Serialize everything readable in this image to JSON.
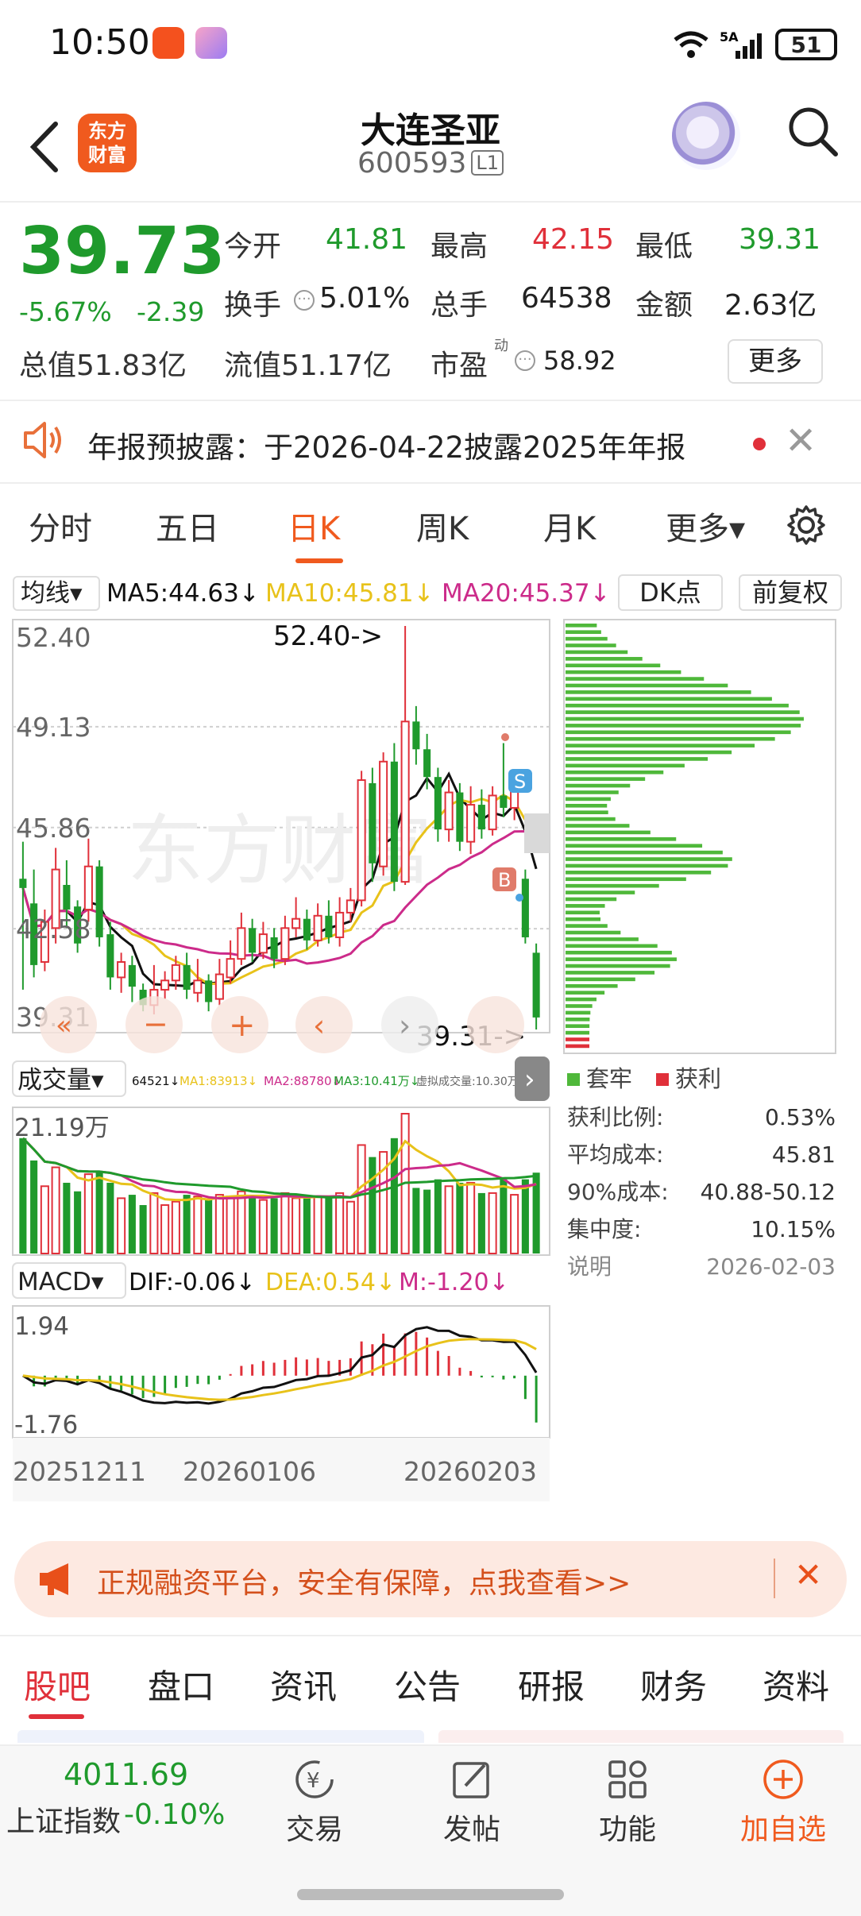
{
  "status_bar": {
    "time": "10:50",
    "battery": "51",
    "network": "5A"
  },
  "header": {
    "stock_name": "大连圣亚",
    "stock_code": "600593",
    "level_badge": "L1",
    "logo_text_line1": "东方",
    "logo_text_line2": "财富"
  },
  "quote": {
    "price": "39.73",
    "change_pct": "-5.67%",
    "change_amt": "-2.39",
    "open_label": "今开",
    "open": "41.81",
    "high_label": "最高",
    "high": "42.15",
    "low_label": "最低",
    "low": "39.31",
    "turnover_label": "换手",
    "turnover": "5.01%",
    "volume_label": "总手",
    "volume": "64538",
    "amount_label": "金额",
    "amount": "2.63亿",
    "total_cap": "总值51.83亿",
    "float_cap": "流值51.17亿",
    "pe_label": "市盈",
    "pe_sup": "动",
    "pe": "58.92",
    "more_label": "更多"
  },
  "notice": {
    "text": "年报预披露：于2026-04-22披露2025年年报"
  },
  "period_tabs": [
    "分时",
    "五日",
    "日K",
    "周K",
    "月K",
    "更多▾"
  ],
  "ma_legend": {
    "select": "均线▾",
    "ma5": "MA5:44.63↓",
    "ma10": "MA10:45.81↓",
    "ma20": "MA20:45.37↓",
    "dk_button": "DK点",
    "adjust_button": "前复权"
  },
  "kline": {
    "y_labels": [
      "52.40",
      "49.13",
      "45.86",
      "42.58",
      "39.31"
    ],
    "max_marker": "52.40->",
    "min_marker": "39.31->",
    "buy_sign": "B",
    "sell_sign": "S",
    "watermark": "东方财富"
  },
  "volume": {
    "select": "成交量▾",
    "legend": [
      "64521↓",
      "MA1:83913↓",
      "MA2:88780↓",
      "MA3:10.41万↓",
      "虚拟成交量:10.30万"
    ],
    "y_label": "21.19万"
  },
  "macd": {
    "select": "MACD▾",
    "dif": "DIF:-0.06↓",
    "dea": "DEA:0.54↓",
    "m": "M:-1.20↓",
    "y_top": "1.94",
    "y_bottom": "-1.76"
  },
  "x_dates": [
    "20251211",
    "20260106",
    "20260203"
  ],
  "chip": {
    "legend_hold": "套牢",
    "legend_profit": "获利",
    "rows": [
      {
        "label": "获利比例:",
        "value": "0.53%"
      },
      {
        "label": "平均成本:",
        "value": "45.81"
      },
      {
        "label": "90%成本:",
        "value": "40.88-50.12"
      },
      {
        "label": "集中度:",
        "value": "10.15%"
      },
      {
        "label": "说明",
        "value": "2026-02-03"
      }
    ]
  },
  "ad": {
    "text": "正规融资平台，安全有保障，点我查看>>"
  },
  "content_tabs": [
    "股吧",
    "盘口",
    "资讯",
    "公告",
    "研报",
    "财务",
    "资料"
  ],
  "bottom_nav": {
    "index_value": "4011.69",
    "index_name": "上证指数",
    "index_change": "-0.10%",
    "items": [
      "交易",
      "发帖",
      "功能",
      "加自选"
    ]
  },
  "colors": {
    "up": "#e0303a",
    "down": "#1f9a2c",
    "brand": "#f05a1e",
    "ma5": "#111111",
    "ma10": "#e8c21a",
    "ma20": "#cc2b8a"
  },
  "chart_data": {
    "type": "candlestick",
    "title": "",
    "ylim": [
      39.31,
      52.4
    ],
    "candles": [
      [
        44.2,
        43.9,
        45.4,
        40.6
      ],
      [
        43.4,
        41.4,
        44.5,
        41.0
      ],
      [
        41.5,
        42.8,
        43.2,
        41.2
      ],
      [
        42.6,
        44.5,
        45.2,
        42.1
      ],
      [
        44.0,
        43.2,
        44.8,
        42.6
      ],
      [
        43.3,
        42.1,
        43.5,
        41.8
      ],
      [
        43.2,
        44.6,
        45.5,
        42.8
      ],
      [
        44.6,
        42.3,
        44.8,
        42.0
      ],
      [
        42.4,
        41.0,
        42.8,
        40.6
      ],
      [
        41.0,
        41.5,
        41.8,
        40.5
      ],
      [
        41.4,
        40.7,
        41.7,
        40.2
      ],
      [
        40.6,
        40.1,
        40.8,
        39.9
      ],
      [
        40.1,
        40.6,
        41.4,
        39.8
      ],
      [
        40.6,
        40.9,
        41.2,
        40.3
      ],
      [
        40.9,
        41.4,
        41.7,
        40.6
      ],
      [
        41.4,
        40.6,
        41.8,
        40.3
      ],
      [
        40.5,
        40.9,
        41.6,
        40.2
      ],
      [
        40.9,
        40.2,
        41.1,
        39.9
      ],
      [
        40.3,
        41.1,
        41.6,
        40.1
      ],
      [
        41.0,
        41.6,
        42.2,
        40.8
      ],
      [
        41.6,
        42.6,
        43.1,
        41.4
      ],
      [
        42.6,
        41.8,
        42.9,
        41.5
      ],
      [
        41.8,
        42.4,
        42.8,
        41.6
      ],
      [
        42.3,
        41.6,
        42.6,
        41.3
      ],
      [
        41.6,
        42.6,
        43.0,
        41.4
      ],
      [
        42.6,
        42.9,
        43.6,
        42.3
      ],
      [
        42.9,
        42.2,
        43.2,
        41.9
      ],
      [
        42.2,
        43.0,
        43.4,
        42.0
      ],
      [
        43.0,
        42.3,
        43.5,
        42.1
      ],
      [
        42.3,
        43.1,
        43.6,
        42.0
      ],
      [
        43.1,
        43.5,
        43.9,
        42.8
      ],
      [
        43.5,
        47.4,
        47.7,
        43.3
      ],
      [
        47.3,
        44.7,
        47.8,
        44.1
      ],
      [
        44.6,
        48.0,
        48.3,
        44.3
      ],
      [
        48.0,
        44.1,
        48.6,
        43.8
      ],
      [
        44.1,
        49.3,
        52.4,
        44.0
      ],
      [
        49.3,
        48.4,
        49.8,
        47.9
      ],
      [
        48.4,
        47.5,
        48.9,
        47.1
      ],
      [
        47.5,
        45.8,
        47.8,
        45.4
      ],
      [
        45.8,
        47.0,
        47.4,
        45.4
      ],
      [
        47.0,
        45.4,
        47.3,
        45.1
      ],
      [
        45.4,
        46.6,
        47.2,
        45.0
      ],
      [
        46.6,
        45.8,
        47.1,
        45.5
      ],
      [
        45.8,
        46.9,
        47.2,
        45.6
      ],
      [
        46.9,
        46.5,
        48.6,
        46.2
      ],
      [
        46.5,
        47.2,
        47.6,
        46.1
      ],
      [
        44.2,
        42.3,
        44.5,
        42.1
      ],
      [
        41.8,
        39.7,
        42.1,
        39.31
      ]
    ],
    "volume_ylim": [
      0,
      21.19
    ],
    "macd_ylim": [
      -1.76,
      1.94
    ],
    "x_ticks": [
      "20251211",
      "20260106",
      "20260203"
    ]
  }
}
